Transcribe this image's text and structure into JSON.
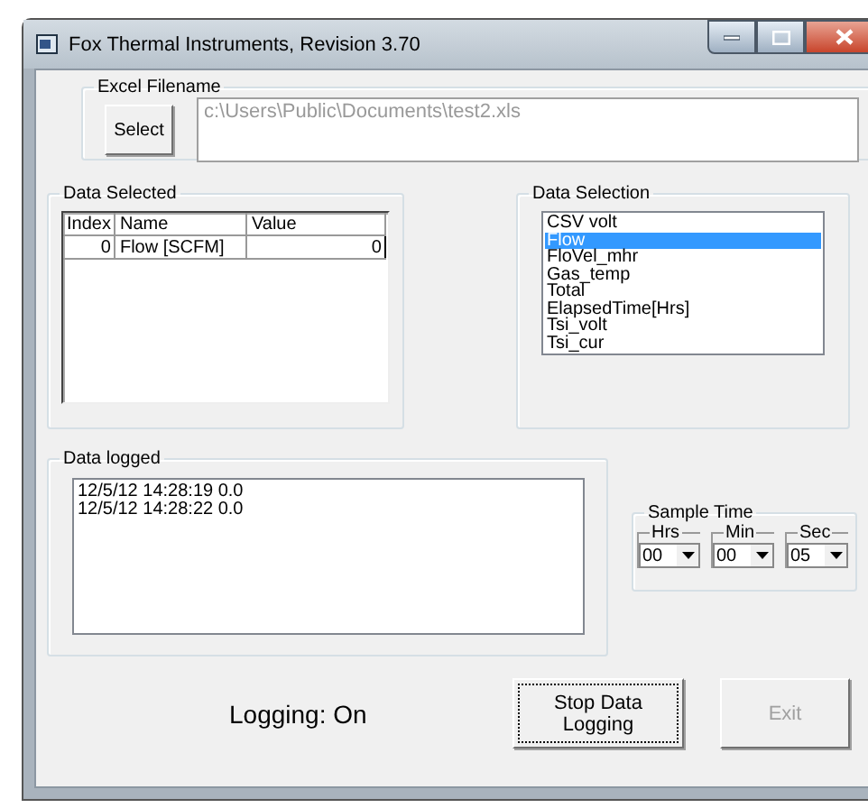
{
  "window": {
    "title": "Fox Thermal Instruments,  Revision 3.70"
  },
  "excel_filename": {
    "label": "Excel Filename",
    "button": "Select",
    "value": "c:\\Users\\Public\\Documents\\test2.xls"
  },
  "data_selected": {
    "label": "Data Selected",
    "columns": [
      "Index",
      "Name",
      "Value"
    ],
    "rows": [
      {
        "index": "0",
        "name": "Flow [SCFM]",
        "value": "0"
      }
    ]
  },
  "data_selection": {
    "label": "Data Selection",
    "items": [
      {
        "label": "CSV volt",
        "selected": false
      },
      {
        "label": "Flow",
        "selected": true
      },
      {
        "label": "FloVel_mhr",
        "selected": false
      },
      {
        "label": "Gas_temp",
        "selected": false
      },
      {
        "label": "Total",
        "selected": false
      },
      {
        "label": "ElapsedTime[Hrs]",
        "selected": false
      },
      {
        "label": "Tsi_volt",
        "selected": false
      },
      {
        "label": "Tsi_cur",
        "selected": false
      }
    ]
  },
  "data_logged": {
    "label": "Data logged",
    "lines": [
      "12/5/12 14:28:19  0.0",
      "12/5/12 14:28:22  0.0"
    ]
  },
  "sample_time": {
    "label": "Sample Time",
    "fields": [
      {
        "label": "Hrs",
        "value": "00"
      },
      {
        "label": "Min",
        "value": "00"
      },
      {
        "label": "Sec",
        "value": "05"
      }
    ]
  },
  "status": "Logging: On",
  "buttons": [
    {
      "label": "Stop Data Logging",
      "disabled": false,
      "focused": true
    },
    {
      "label": "Exit",
      "disabled": true,
      "focused": false
    }
  ]
}
